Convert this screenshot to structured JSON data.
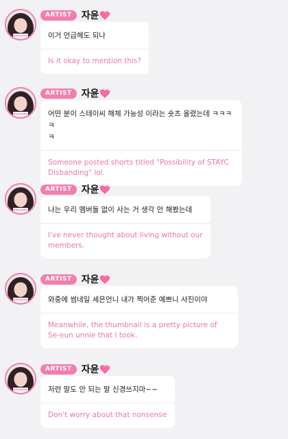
{
  "accent_color": "#f07fae",
  "translation_color": "#ec75a4",
  "heart_icon": "sparkling-heart-icon",
  "messages": [
    {
      "badge": "ARTIST",
      "name": "자윤",
      "text": "이거 언급해도 되나",
      "translation": "Is it okay to mention this?"
    },
    {
      "badge": "ARTIST",
      "name": "자윤",
      "text": "어떤 분이 스테이씨 해체 가능성 이라는 숏츠 올렸는데 ㅋㅋㅋㅋ\nㅋ",
      "translation": "Someone posted shorts titled \"Possibility of STAYC Disbanding\" lol."
    },
    {
      "badge": "ARTIST",
      "name": "자윤",
      "text": "나는 우리 멤버들 없이 사는 거 생각 안 해봤는데",
      "translation": "I've never thought about living without our members."
    },
    {
      "badge": "ARTIST",
      "name": "자윤",
      "text": "와중에 썸네일 세은언니 내가 찍어준 예쁘니 사진이야",
      "translation": "Meanwhile, the thumbnail is a pretty picture of Se-eun unnie that I took."
    },
    {
      "badge": "ARTIST",
      "name": "자윤",
      "text": "저런 말도 안 되는 말 신경쓰지마~~",
      "translation": "Don't worry about that nonsense"
    }
  ]
}
